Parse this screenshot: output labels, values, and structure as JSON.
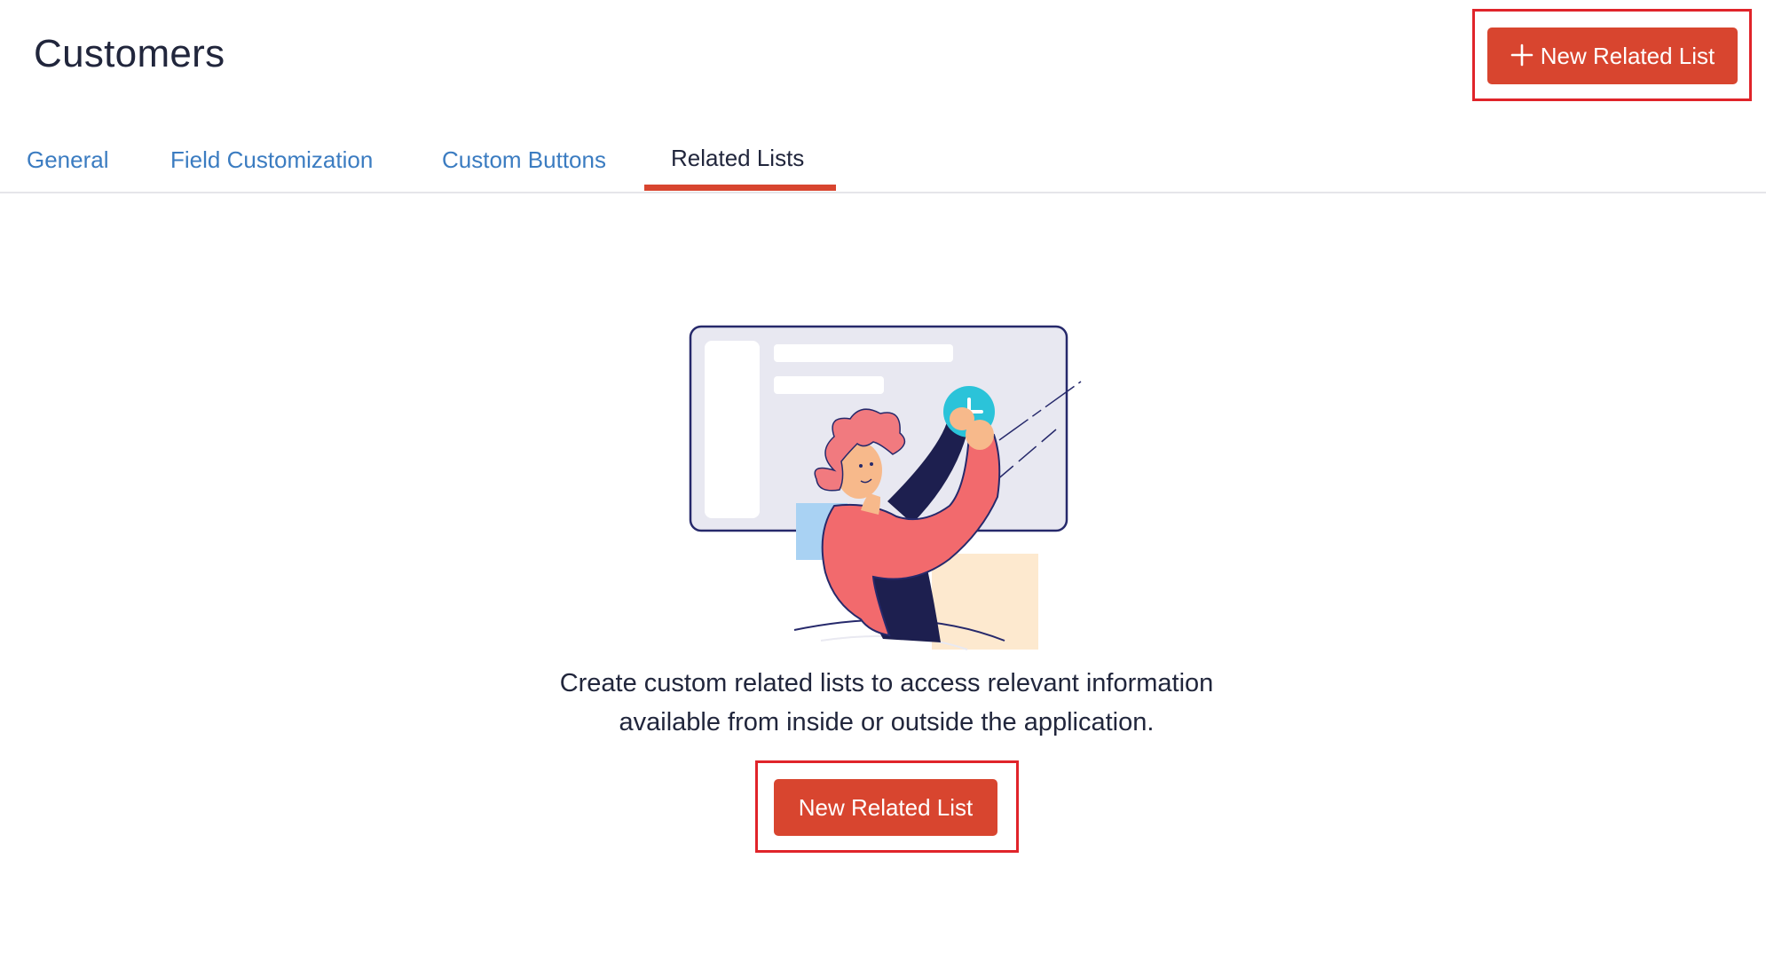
{
  "header": {
    "title": "Customers",
    "new_related_list_label": "New Related List"
  },
  "tabs": [
    {
      "label": "General",
      "active": false
    },
    {
      "label": "Field Customization",
      "active": false
    },
    {
      "label": "Custom Buttons",
      "active": false
    },
    {
      "label": "Related Lists",
      "active": true
    }
  ],
  "empty_state": {
    "line1": "Create custom related lists to access relevant information",
    "line2": "available from inside or outside the application.",
    "button_label": "New Related List"
  },
  "colors": {
    "primary": "#d8452f",
    "tab_link": "#3b7cc1",
    "highlight": "#e0242a",
    "text": "#21263c"
  }
}
